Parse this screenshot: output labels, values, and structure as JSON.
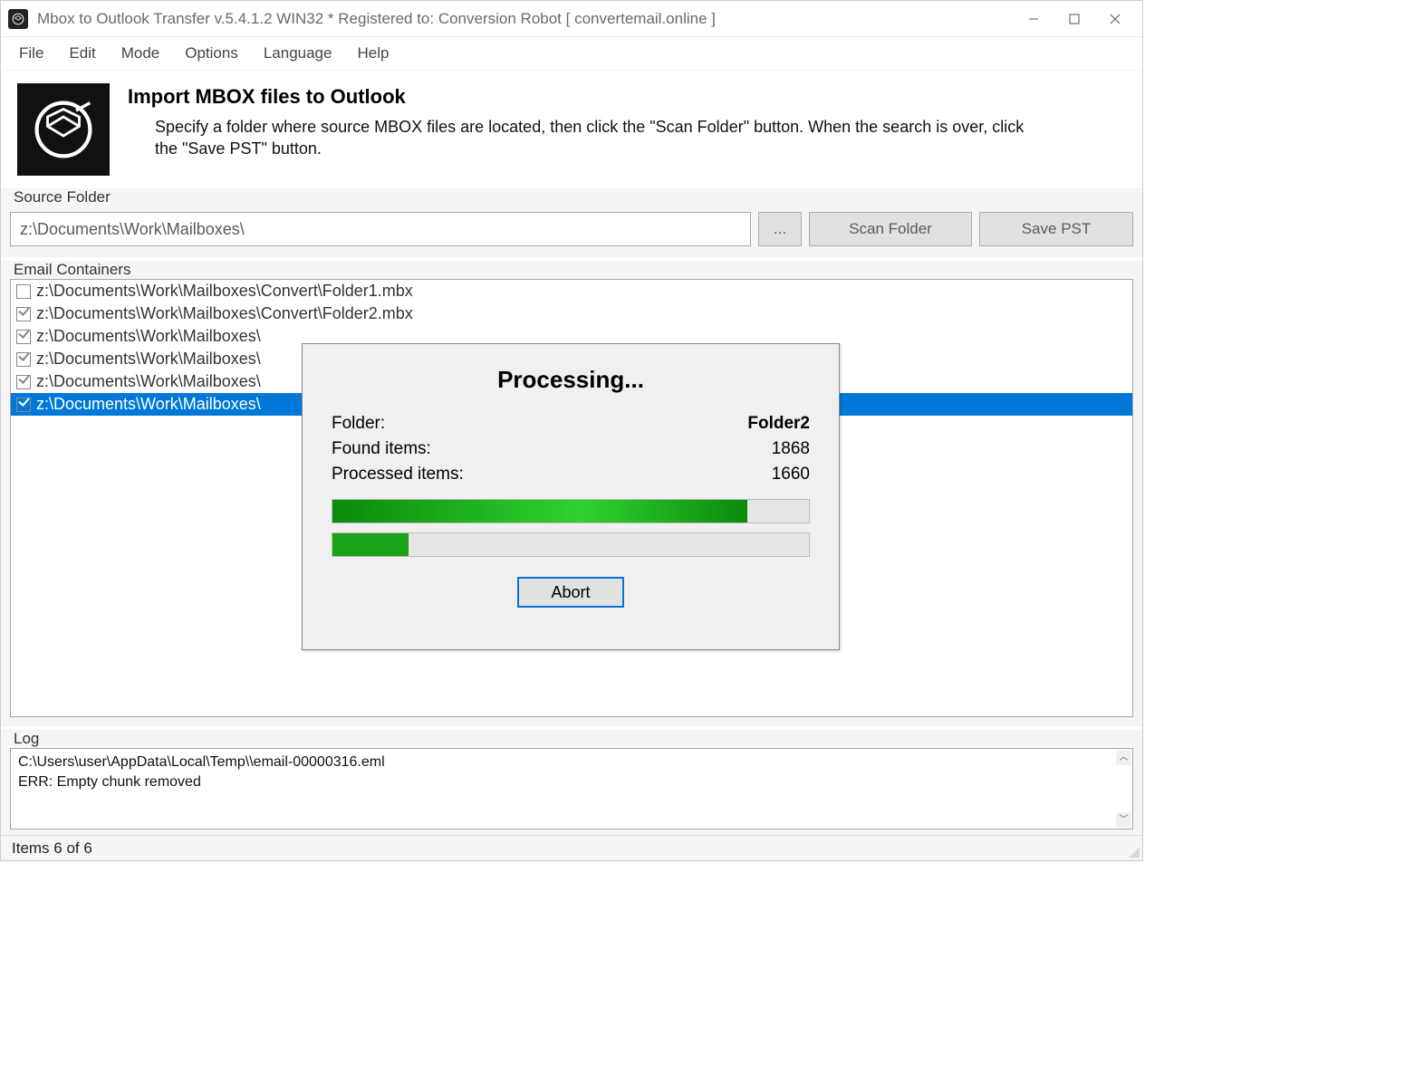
{
  "titlebar": {
    "text": "Mbox to Outlook Transfer v.5.4.1.2 WIN32 * Registered to: Conversion Robot [ convertemail.online ]"
  },
  "menu": {
    "items": [
      "File",
      "Edit",
      "Mode",
      "Options",
      "Language",
      "Help"
    ]
  },
  "header": {
    "title": "Import MBOX files to Outlook",
    "desc": "Specify a folder where source MBOX files are located, then click the \"Scan Folder\" button. When the search is over, click the \"Save PST\" button."
  },
  "source": {
    "label": "Source Folder",
    "path": "z:\\Documents\\Work\\Mailboxes\\",
    "browse": "...",
    "scan": "Scan Folder",
    "save": "Save PST"
  },
  "containers": {
    "label": "Email Containers",
    "items": [
      {
        "path": "z:\\Documents\\Work\\Mailboxes\\Convert\\Folder1.mbx",
        "checked": false,
        "selected": false
      },
      {
        "path": "z:\\Documents\\Work\\Mailboxes\\Convert\\Folder2.mbx",
        "checked": true,
        "selected": false
      },
      {
        "path": "z:\\Documents\\Work\\Mailboxes\\",
        "checked": true,
        "selected": false
      },
      {
        "path": "z:\\Documents\\Work\\Mailboxes\\",
        "checked": true,
        "selected": false
      },
      {
        "path": "z:\\Documents\\Work\\Mailboxes\\",
        "checked": true,
        "selected": false
      },
      {
        "path": "z:\\Documents\\Work\\Mailboxes\\",
        "checked": true,
        "selected": true
      }
    ]
  },
  "log": {
    "label": "Log",
    "lines": [
      "C:\\Users\\user\\AppData\\Local\\Temp\\\\email-00000316.eml",
      "ERR: Empty chunk removed"
    ]
  },
  "status": {
    "text": "Items 6 of 6"
  },
  "dialog": {
    "title": "Processing...",
    "folder_label": "Folder:",
    "folder_value": "Folder2",
    "found_label": "Found items:",
    "found_value": "1868",
    "processed_label": "Processed items:",
    "processed_value": "1660",
    "progress1_pct": 87,
    "progress2_pct": 16,
    "abort": "Abort"
  }
}
